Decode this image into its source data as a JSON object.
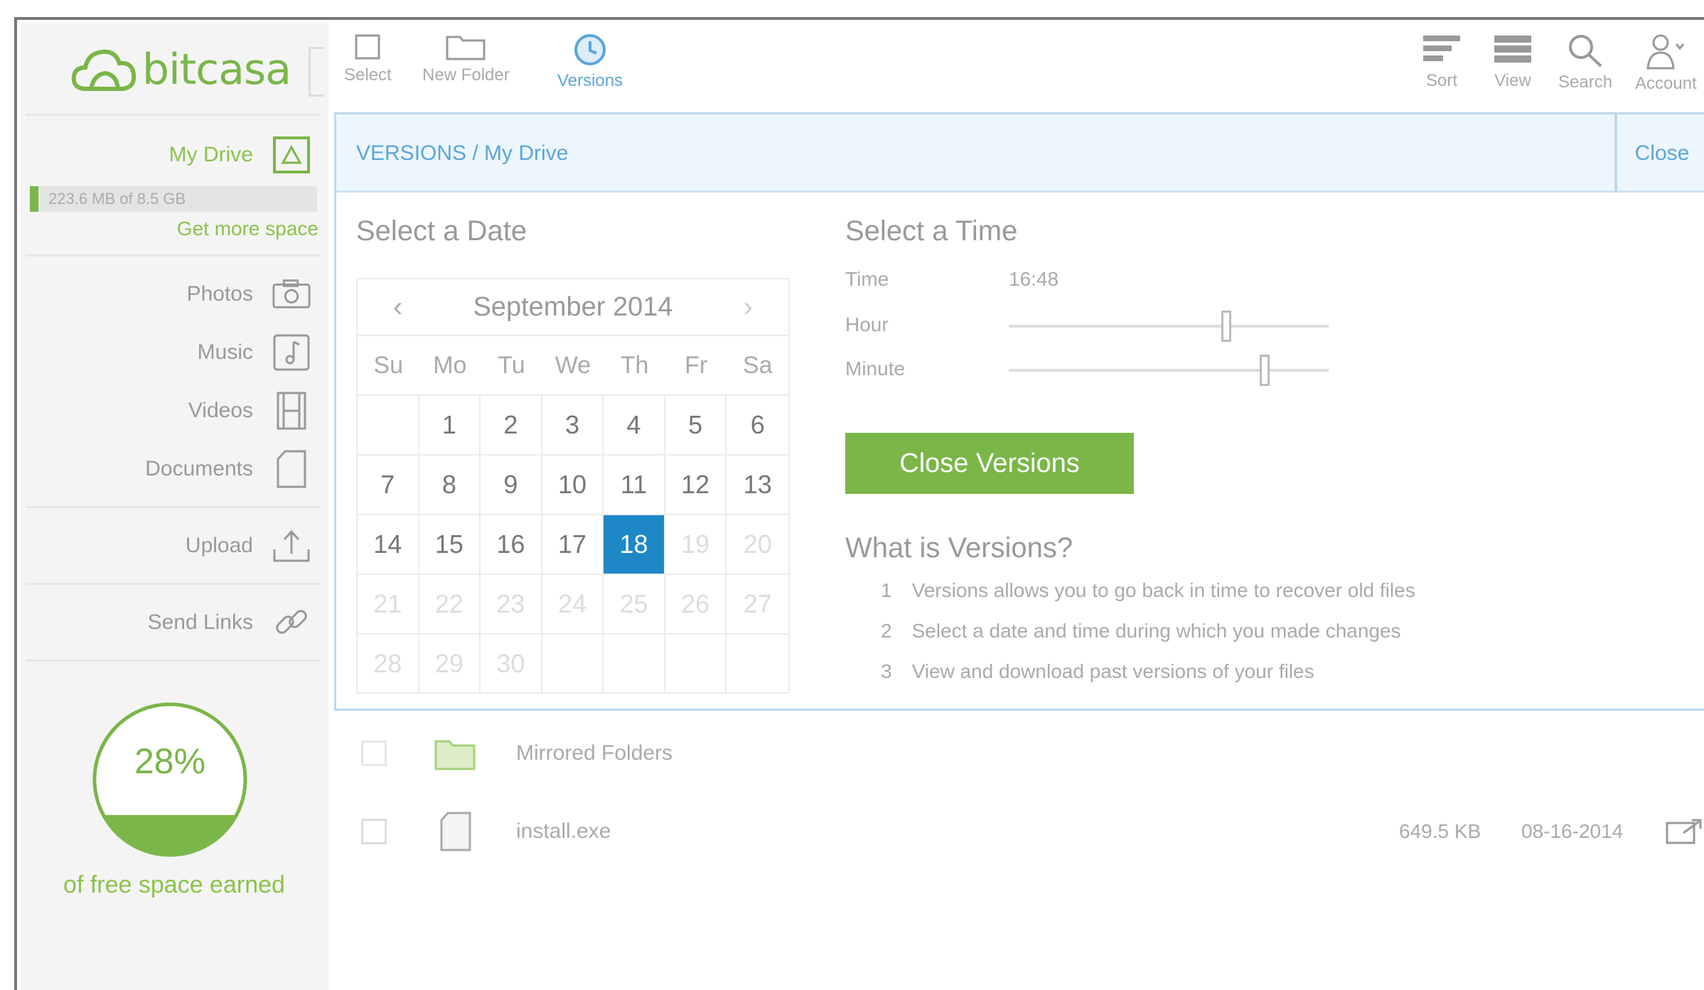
{
  "brand": {
    "name": "bitcasa"
  },
  "toolbar": {
    "select": "Select",
    "new_folder": "New Folder",
    "versions": "Versions",
    "sort": "Sort",
    "view": "View",
    "search": "Search",
    "account": "Account"
  },
  "sidebar": {
    "my_drive": "My Drive",
    "storage_text": "223.6 MB of 8.5 GB",
    "more_space": "Get more space",
    "items": [
      {
        "label": "Photos",
        "icon": "camera-icon"
      },
      {
        "label": "Music",
        "icon": "music-icon"
      },
      {
        "label": "Videos",
        "icon": "film-icon"
      },
      {
        "label": "Documents",
        "icon": "document-icon"
      }
    ],
    "upload": "Upload",
    "send_links": "Send Links",
    "earned_percent": "28%",
    "earned_fraction": 0.28,
    "earned_caption": "of free space earned"
  },
  "versions": {
    "breadcrumb": "VERSIONS / My Drive",
    "close": "Close",
    "select_date": "Select a Date",
    "select_time": "Select a Time",
    "calendar": {
      "month": "September 2014",
      "prev": "‹",
      "next": "›",
      "weekdays": [
        "Su",
        "Mo",
        "Tu",
        "We",
        "Th",
        "Fr",
        "Sa"
      ],
      "selected_day": "18"
    },
    "time_label": "Time",
    "time_value": "16:48",
    "hour_label": "Hour",
    "minute_label": "Minute",
    "hour_fraction": 0.68,
    "minute_fraction": 0.8,
    "close_button": "Close Versions",
    "whatis_title": "What is Versions?",
    "steps": [
      {
        "num": "1",
        "text": "Versions allows you to go back in time to recover old files"
      },
      {
        "num": "2",
        "text": "Select a date and time during which you made changes"
      },
      {
        "num": "3",
        "text": "View and download past versions of your files"
      }
    ]
  },
  "files": [
    {
      "name": "Mirrored Folders",
      "size": "",
      "date": "",
      "icon": "folder-icon"
    },
    {
      "name": "install.exe",
      "size": "649.5 KB",
      "date": "08-16-2014",
      "icon": "file-icon"
    }
  ],
  "colors": {
    "accent_green": "#7ab648",
    "accent_blue": "#1e88c7",
    "link_blue": "#5aa6d8"
  }
}
